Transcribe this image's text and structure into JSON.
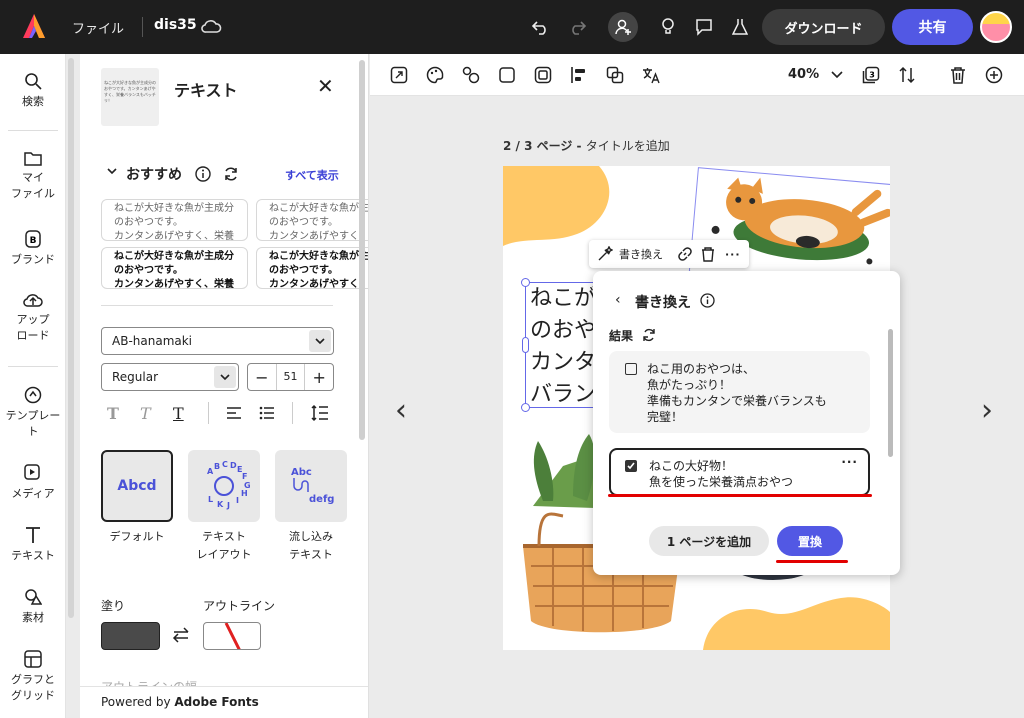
{
  "topbar": {
    "file_menu": "ファイル",
    "doc_name": "dis35",
    "download_label": "ダウンロード",
    "share_label": "共有"
  },
  "rail": {
    "items": [
      {
        "label": "検索",
        "icon": "search-icon"
      },
      {
        "label": "マイ\nファイル",
        "icon": "folder-icon"
      },
      {
        "label": "ブランド",
        "icon": "brand-icon"
      },
      {
        "label": "アップ\nロード",
        "icon": "upload-icon"
      },
      {
        "label": "テンプレー\nト",
        "icon": "template-icon"
      },
      {
        "label": "メディア",
        "icon": "media-icon"
      },
      {
        "label": "テキスト",
        "icon": "text-icon"
      },
      {
        "label": "素材",
        "icon": "elements-icon"
      },
      {
        "label": "グラフと\nグリッド",
        "icon": "grid-icon"
      }
    ]
  },
  "panel": {
    "title": "テキスト",
    "thumb_text": "ねこが大好きな魚が主成分のおやつです。カンタンあげやすく、栄養バランスもバッチリ！",
    "recommended": "おすすめ",
    "see_all": "すべて表示",
    "cards": [
      {
        "lines": [
          "ねこが大好きな魚が主成分",
          "のおやつです。",
          "カンタンあげやすく、栄養"
        ]
      },
      {
        "lines": [
          "ねこが大好きな魚が主",
          "のおやつです。",
          "カンタンあげやすく"
        ]
      },
      {
        "lines": [
          "ねこが大好きな魚が主成分",
          "のおやつです。",
          "カンタンあげやすく、栄養"
        ]
      },
      {
        "lines": [
          "ねこが大好きな魚が主",
          "のおやつです。",
          "カンタンあげやすく"
        ]
      }
    ],
    "font_family": "AB-hanamaki",
    "font_style": "Regular",
    "font_size": "51",
    "styles": [
      {
        "label": "デフォルト",
        "preview": "Abcd"
      },
      {
        "label": "テキスト\nレイアウト",
        "preview": "ABCDEFGHIJKL"
      },
      {
        "label": "流し込み\nテキスト",
        "preview_top": "Abc",
        "preview_bottom": "defg"
      }
    ],
    "fill_label": "塗り",
    "outline_label": "アウトライン",
    "fill_color": "#4a4a4a",
    "cut_text": "アウトラインの幅",
    "powered_prefix": "Powered by ",
    "powered_brand": "Adobe Fonts"
  },
  "canvas_toolbar": {
    "zoom": "40%"
  },
  "canvas": {
    "page_number": "2 / 3 ページ - ",
    "page_title_placeholder": "タイトルを追加",
    "text_lines": [
      "ねこが",
      "のおや",
      "カンタ",
      "バラン"
    ]
  },
  "context_toolbar": {
    "rewrite_label": "書き換え"
  },
  "rewrite_popup": {
    "title": "書き換え",
    "result_label": "結果",
    "options": [
      {
        "text": "ねこ用のおやつは、\n魚がたっぷり！\n準備もカンタンで栄養バランスも\n完璧！",
        "checked": false
      },
      {
        "text": "ねこの大好物！\n魚を使った栄養満点おやつ",
        "checked": true
      }
    ],
    "add_page_label": "1 ページを追加",
    "replace_label": "置換"
  },
  "colors": {
    "accent": "#5258e4",
    "annotation_red": "#e20000",
    "topbar_bg": "#1e1e1e"
  }
}
